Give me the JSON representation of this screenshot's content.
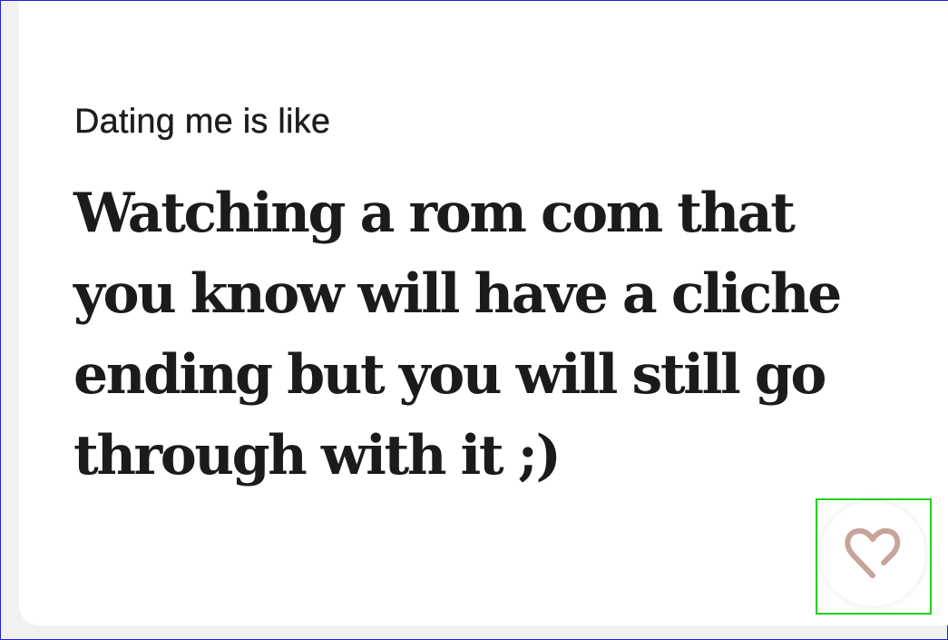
{
  "prompt": {
    "label": "Dating me is like",
    "answer": "Watching a rom com that you know will have a cliche ending but you will still go through with it ;)"
  },
  "like": {
    "icon": "heart-icon",
    "color": "#c8a49a"
  },
  "colors": {
    "card_background": "#ffffff",
    "page_background": "#f2f1ef",
    "text": "#1b1b1b",
    "highlight_outline": "#21d321"
  }
}
